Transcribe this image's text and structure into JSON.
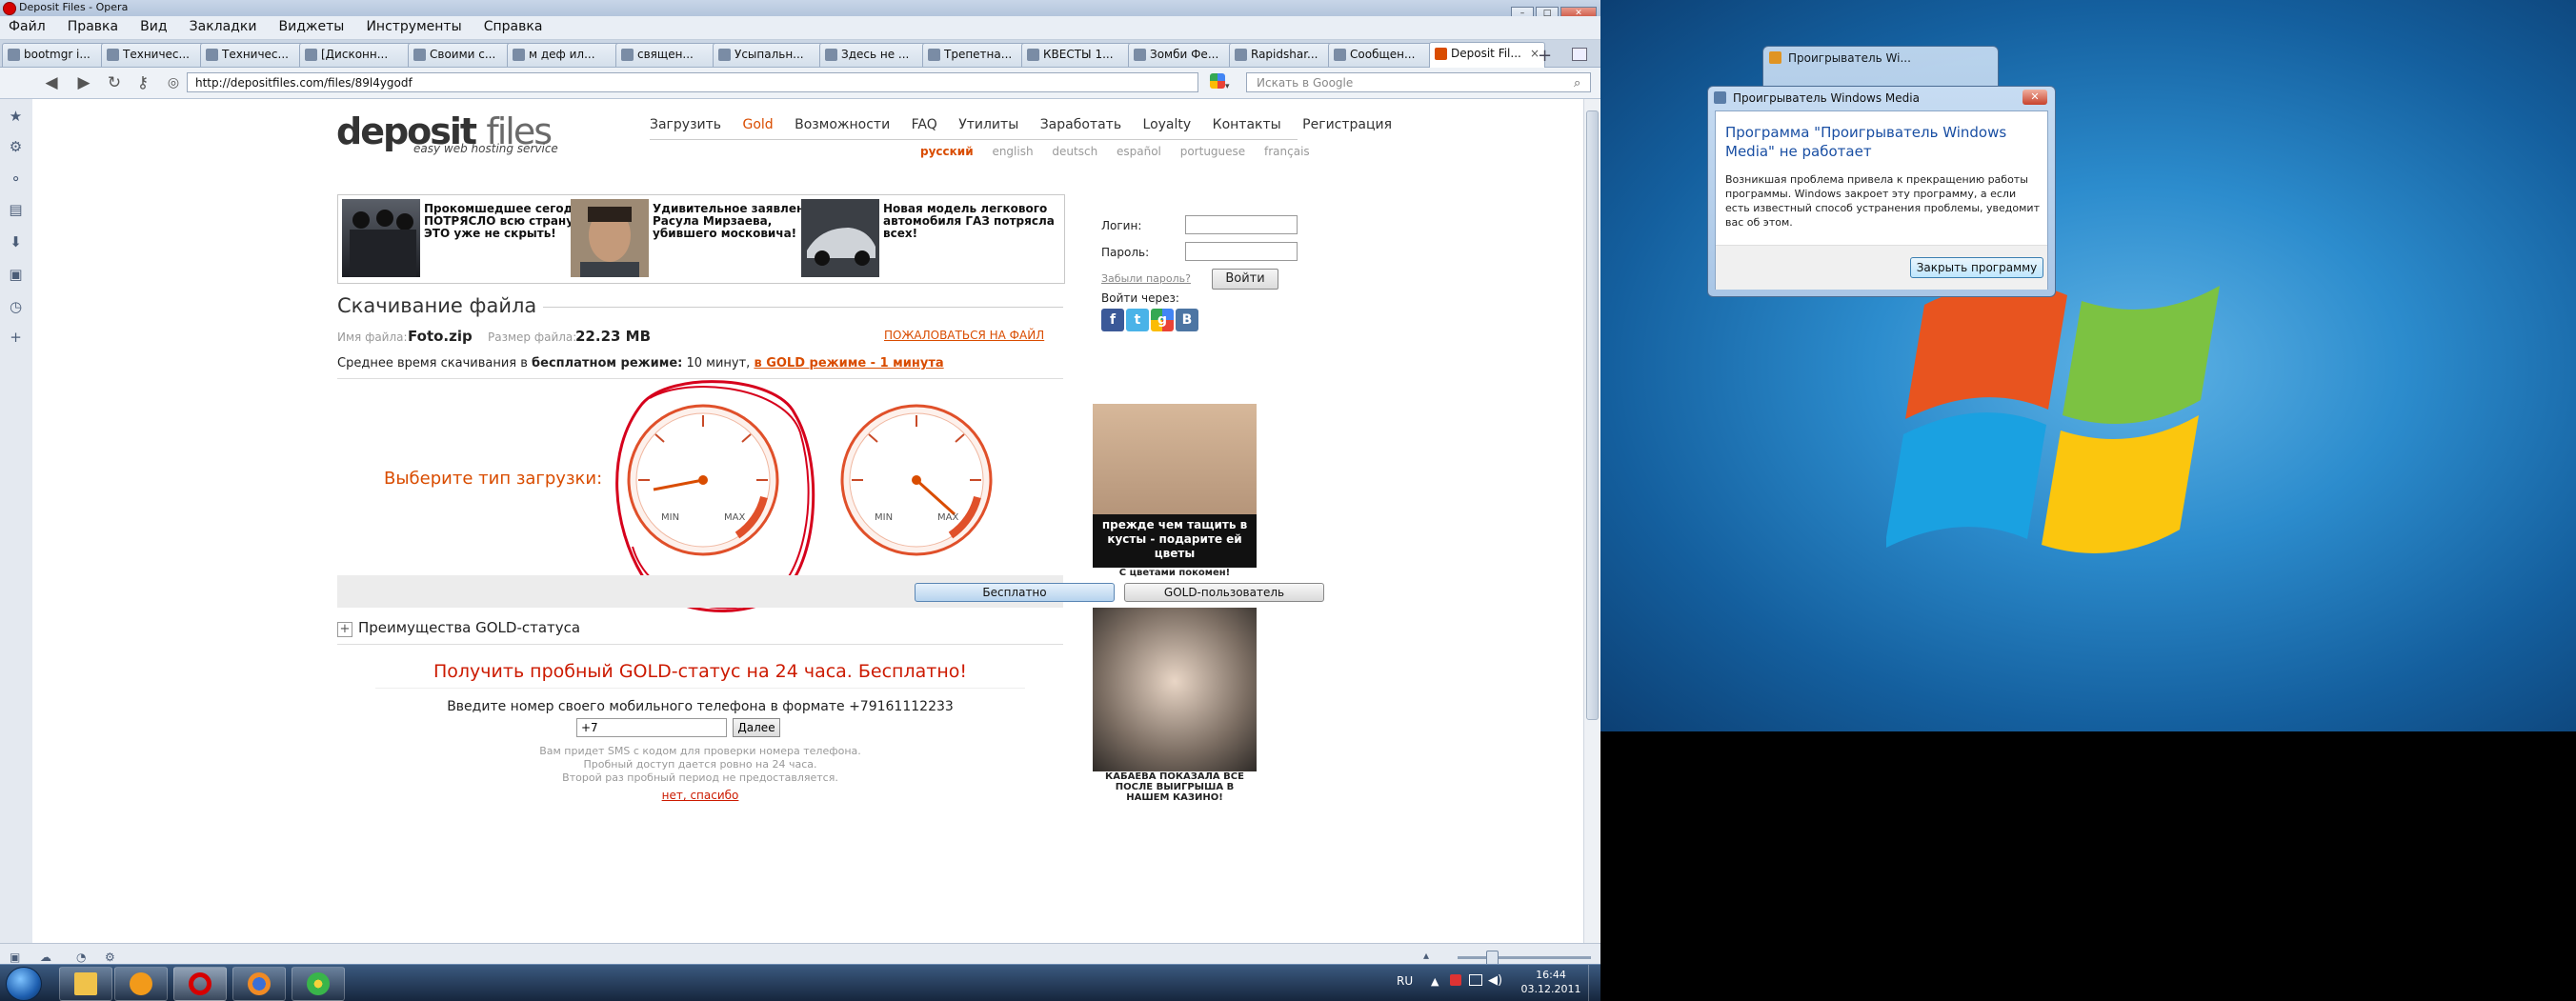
{
  "window": {
    "title": "Deposit Files - Opera"
  },
  "menu": [
    "Файл",
    "Правка",
    "Вид",
    "Закладки",
    "Виджеты",
    "Инструменты",
    "Справка"
  ],
  "tabs": [
    {
      "label": "bootmgr i..."
    },
    {
      "label": "Техничес..."
    },
    {
      "label": "Техничес..."
    },
    {
      "label": "[Дисконн..."
    },
    {
      "label": "Своими с..."
    },
    {
      "label": "м деф ил..."
    },
    {
      "label": "священ..."
    },
    {
      "label": "Усыпальн..."
    },
    {
      "label": "Здесь не ..."
    },
    {
      "label": "Трепетна..."
    },
    {
      "label": "КВЕСТЫ 1..."
    },
    {
      "label": "Зомби Фе..."
    },
    {
      "label": "Rapidshar..."
    },
    {
      "label": "Сообщен..."
    },
    {
      "label": "Deposit Fil..."
    }
  ],
  "address": {
    "url": "http://depositfiles.com/files/89l4ygodf",
    "search_placeholder": "Искать в Google"
  },
  "site": {
    "logo_main": "deposit",
    "logo_files": "files",
    "logo_sub": "easy web hosting service",
    "nav": [
      "Загрузить",
      "Gold",
      "Возможности",
      "FAQ",
      "Утилиты",
      "Заработать",
      "Loyalty",
      "Контакты",
      "Регистрация"
    ],
    "langs": [
      "русский",
      "english",
      "deutsch",
      "español",
      "portuguese",
      "français"
    ]
  },
  "ads": [
    {
      "text": "Прокомшедшее сегодня ПОТРЯСЛО всю страну! ЭТО уже не скрыть!"
    },
    {
      "text": "Удивительное заявление Расула Мирзаева, убившего московича!"
    },
    {
      "text": "Новая модель легкового автомобиля ГАЗ потрясла всех!"
    }
  ],
  "login": {
    "login_label": "Логин:",
    "password_label": "Пароль:",
    "forgot": "Забыли пароль?",
    "button": "Войти",
    "via": "Войти через:",
    "social": [
      "f",
      "t",
      "g",
      "B"
    ]
  },
  "download": {
    "title": "Скачивание файла",
    "filename_label": "Имя файла:",
    "filename": "Foto.zip",
    "size_label": "Размер файла:",
    "size": "22.23 MB",
    "complain": "ПОЖАЛОВАТЬСЯ НА ФАЙЛ",
    "avg_prefix": "Среднее время скачивания в",
    "avg_free_mode": "бесплатном режиме:",
    "avg_free_time": "10 минут,",
    "avg_gold": "в GOLD режиме - 1 минута",
    "choose": "Выберите тип загрузки:",
    "gauge_min": "MIN",
    "gauge_max": "MAX",
    "btn_free": "Бесплатно",
    "btn_gold": "GOLD-пользователь",
    "benefits": "Преимущества GOLD-статуса"
  },
  "trial": {
    "title": "Получить пробный GOLD-статус на 24 часа. Бесплатно!",
    "prompt": "Введите номер своего мобильного телефона в формате +79161112233",
    "phone_value": "+7",
    "next": "Далее",
    "note1": "Вам придет SMS с кодом для проверки номера телефона.",
    "note2": "Пробный доступ дается ровно на 24 часа.",
    "note3": "Второй раз пробный период не предоставляется.",
    "no_thanks": "нет, спасибо"
  },
  "side_ads": [
    {
      "caption_big": "прежде чем тащить в кусты - подарите ей цветы",
      "caption": "С цветами покомен!"
    },
    {
      "caption": "КАБАЕВА ПОКАЗАЛА ВСЕ ПОСЛЕ ВЫИГРЫША В НАШЕМ КАЗИНО!"
    }
  ],
  "dialog": {
    "back_title": "Проигрыватель Wi...",
    "title": "Проигрыватель Windows Media",
    "heading": "Программа \"Проигрыватель Windows Media\" не работает",
    "message": "Возникшая проблема привела к прекращению работы программы. Windows закроет эту программу, а если есть известный способ устранения проблемы, уведомит вас об этом.",
    "close_button": "Закрыть программу"
  },
  "taskbar": {
    "lang": "RU",
    "time": "16:44",
    "date": "03.12.2011"
  },
  "colors": {
    "accent": "#d94c00",
    "trial_red": "#cc1a00",
    "dialog_blue": "#1a4fa3"
  }
}
